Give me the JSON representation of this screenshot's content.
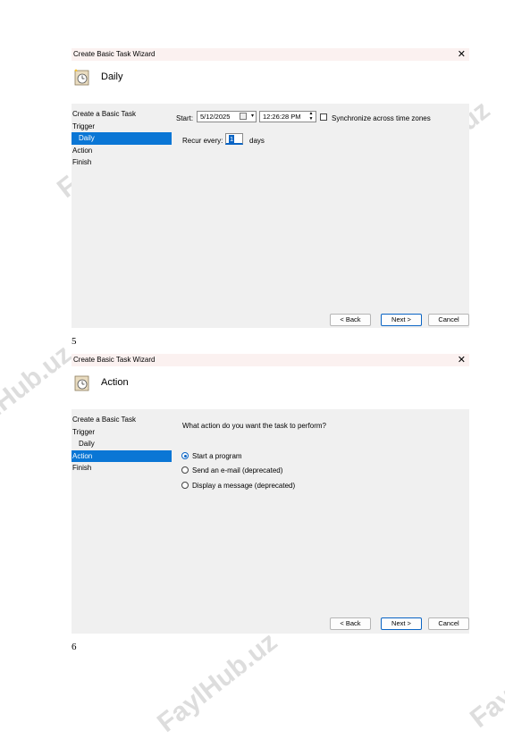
{
  "page_numbers": [
    "5",
    "6"
  ],
  "watermark": "FaylHub.uz",
  "wizard_top": {
    "title": "Create Basic Task Wizard",
    "close_glyph": "✕",
    "header_title": "Daily",
    "nav": [
      {
        "label": "Create a Basic Task"
      },
      {
        "label": "Trigger"
      },
      {
        "label": "Daily"
      },
      {
        "label": "Action"
      },
      {
        "label": "Finish"
      }
    ],
    "start_label": "Start:",
    "start_date": "5/12/2025",
    "start_time": "12:26:28 PM",
    "sync_label": "Synchronize across time zones",
    "recur_label": "Recur every:",
    "recur_value": "1",
    "recur_unit": "days",
    "buttons": {
      "back": "< Back",
      "next": "Next >",
      "cancel": "Cancel"
    }
  },
  "wizard_bottom": {
    "title": "Create Basic Task Wizard",
    "close_glyph": "✕",
    "header_title": "Action",
    "nav": [
      {
        "label": "Create a Basic Task"
      },
      {
        "label": "Trigger"
      },
      {
        "label": "Daily"
      },
      {
        "label": "Action"
      },
      {
        "label": "Finish"
      }
    ],
    "question": "What action do you want the task to perform?",
    "options": [
      {
        "label": "Start a program",
        "selected": true
      },
      {
        "label": "Send an e-mail (deprecated)",
        "selected": false
      },
      {
        "label": "Display a message (deprecated)",
        "selected": false
      }
    ],
    "buttons": {
      "back": "< Back",
      "next": "Next >",
      "cancel": "Cancel"
    }
  },
  "colors": {
    "selection": "#0a76d5",
    "dialog_bg": "#f0f0f0",
    "titlebar": "#fbf1f0"
  }
}
